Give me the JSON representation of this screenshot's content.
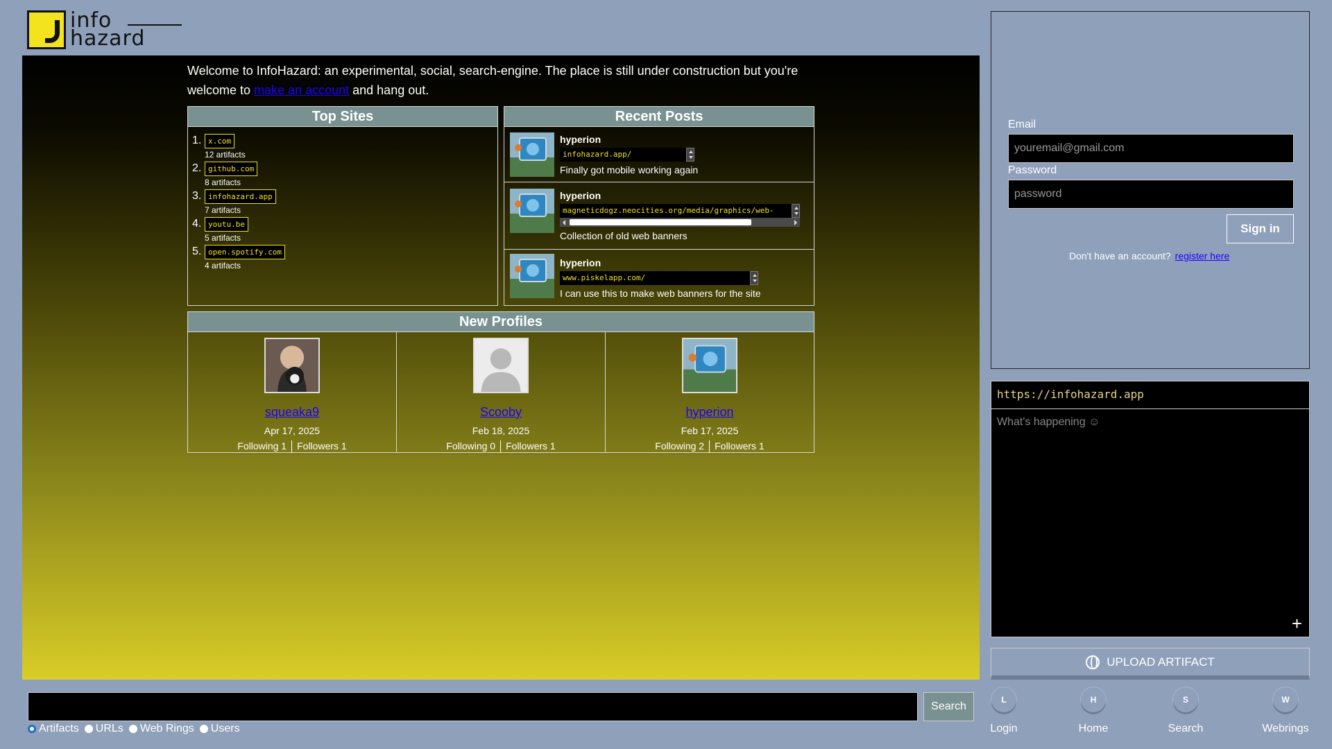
{
  "brand": {
    "line1": "info",
    "line2": "hazard"
  },
  "welcome": {
    "prefix": "Welcome to InfoHazard: an experimental, social, search-engine. The place is still under construction but you're welcome to ",
    "link": "make an account",
    "suffix": " and hang out."
  },
  "top_sites": {
    "title": "Top Sites",
    "items": [
      {
        "num": "1.",
        "site": "x.com",
        "count": "12 artifacts"
      },
      {
        "num": "2.",
        "site": "github.com",
        "count": "8 artifacts"
      },
      {
        "num": "3.",
        "site": "infohazard.app",
        "count": "7 artifacts"
      },
      {
        "num": "4.",
        "site": "youtu.be",
        "count": "5 artifacts"
      },
      {
        "num": "5.",
        "site": "open.spotify.com",
        "count": "4 artifacts"
      }
    ]
  },
  "recent_posts": {
    "title": "Recent Posts",
    "items": [
      {
        "user": "hyperion",
        "url": "infohazard.app/",
        "text": "Finally got mobile working again"
      },
      {
        "user": "hyperion",
        "url": "magneticdogz.neocities.org/media/graphics/web-",
        "text": "Collection of old web banners"
      },
      {
        "user": "hyperion",
        "url": "www.piskelapp.com/",
        "text": "I can use this to make web banners for the site"
      }
    ]
  },
  "new_profiles": {
    "title": "New Profiles",
    "items": [
      {
        "name": "squeaka9",
        "date": "Apr 17, 2025",
        "following": "Following 1",
        "followers": "Followers 1"
      },
      {
        "name": "Scooby",
        "date": "Feb 18, 2025",
        "following": "Following 0",
        "followers": "Followers 1"
      },
      {
        "name": "hyperion",
        "date": "Feb 17, 2025",
        "following": "Following 2",
        "followers": "Followers 1"
      }
    ]
  },
  "search": {
    "button": "Search",
    "value": "",
    "options": [
      {
        "label": "Artifacts",
        "selected": true
      },
      {
        "label": "URLs",
        "selected": false
      },
      {
        "label": "Web Rings",
        "selected": false
      },
      {
        "label": "Users",
        "selected": false
      }
    ]
  },
  "login": {
    "email_label": "Email",
    "email_placeholder": "youremail@gmail.com",
    "password_label": "Password",
    "password_placeholder": "password",
    "signin": "Sign in",
    "no_account": "Don't have an account?",
    "register": "register here"
  },
  "compose": {
    "url": "https://infohazard.app",
    "placeholder": "What's happening ☺",
    "plus": "+"
  },
  "upload": {
    "label": "UPLOAD ARTIFACT",
    "icon": "globe-icon"
  },
  "nav": [
    {
      "key": "L",
      "label": "Login"
    },
    {
      "key": "H",
      "label": "Home"
    },
    {
      "key": "S",
      "label": "Search"
    },
    {
      "key": "W",
      "label": "Webrings"
    }
  ],
  "colors": {
    "accent": "#f2e31d",
    "panel_head": "#7a9191",
    "bg": "#8fa0ba",
    "link": "#1a00ff"
  }
}
